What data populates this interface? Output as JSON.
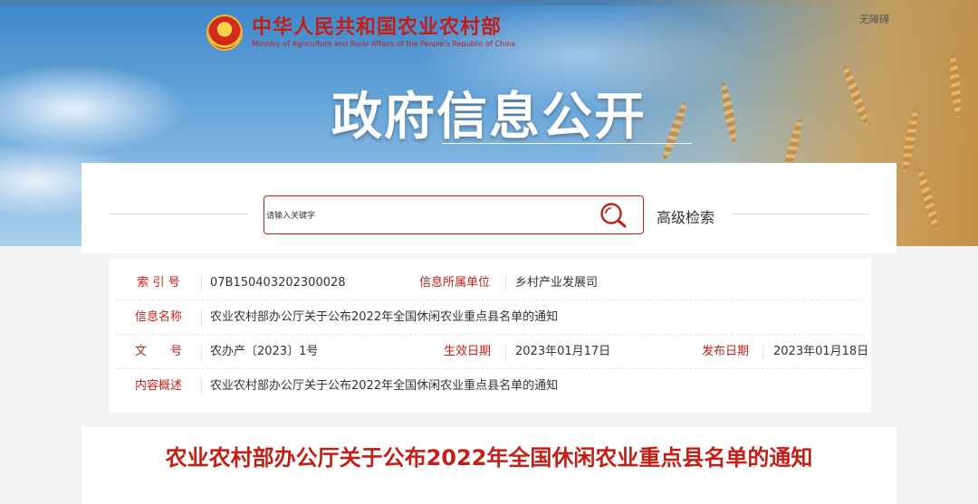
{
  "header": {
    "logo_cn": "中华人民共和国农业农村部",
    "logo_en": "Ministry of Agriculture and Rural Affairs of the People's Republic of China",
    "accessibility": "无障碍",
    "hero_title": "政府信息公开"
  },
  "search": {
    "placeholder": "请输入关键字",
    "advanced": "高级检索"
  },
  "meta": {
    "index_label": "索 引 号",
    "index_value": "07B150403202300028",
    "unit_label": "信息所属单位",
    "unit_value": "乡村产业发展司",
    "name_label": "信息名称",
    "name_value": "农业农村部办公厅关于公布2022年全国休闲农业重点县名单的通知",
    "doc_label": "文　　号",
    "doc_value": "农办产〔2023〕1号",
    "effective_label": "生效日期",
    "effective_value": "2023年01月17日",
    "publish_label": "发布日期",
    "publish_value": "2023年01月18日",
    "summary_label": "内容概述",
    "summary_value": "农业农村部办公厅关于公布2022年全国休闲农业重点县名单的通知"
  },
  "article": {
    "title": "农业农村部办公厅关于公布2022年全国休闲农业重点县名单的通知"
  },
  "colors": {
    "accent": "#c31f17",
    "banner_sky": "#3d86c9"
  },
  "icons": [
    "national-emblem-icon",
    "search-icon"
  ]
}
